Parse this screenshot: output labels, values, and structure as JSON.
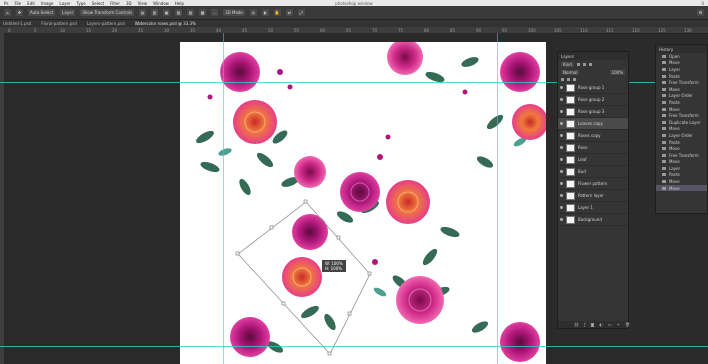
{
  "menu": {
    "items": [
      "Ps",
      "File",
      "Edit",
      "Image",
      "Layer",
      "Type",
      "Select",
      "Filter",
      "3D",
      "View",
      "Window",
      "Help"
    ],
    "title": "photoshop window",
    "right": "0"
  },
  "options": {
    "items": [
      "Auto-Select",
      "Layer",
      "Show Transform Controls",
      "",
      "",
      "",
      "",
      "",
      "",
      "3D Mode"
    ]
  },
  "tabs": [
    "Untitled-1.psd",
    "Floral-pattern.psd",
    "Layers-pattern.psd",
    "Watercolor roses.psd @ 33.3%"
  ],
  "ruler_ticks": [
    "0",
    "5",
    "10",
    "15",
    "20",
    "25",
    "30",
    "35",
    "40",
    "45",
    "50",
    "55",
    "60",
    "65",
    "70",
    "75",
    "80",
    "85",
    "90",
    "95",
    "100",
    "105",
    "110",
    "115",
    "120",
    "125",
    "130"
  ],
  "layers_panel": {
    "title": "Layers",
    "filter_label": "Kind",
    "blend_mode": "Normal",
    "opacity": "100%",
    "layers": [
      {
        "name": "Rose group 1",
        "selected": false
      },
      {
        "name": "Rose group 2",
        "selected": false
      },
      {
        "name": "Rose group 3",
        "selected": false
      },
      {
        "name": "Leaves copy",
        "selected": true
      },
      {
        "name": "Roses copy",
        "selected": false
      },
      {
        "name": "Rose",
        "selected": false
      },
      {
        "name": "Leaf",
        "selected": false
      },
      {
        "name": "Bud",
        "selected": false
      },
      {
        "name": "Flower pattern",
        "selected": false
      },
      {
        "name": "Pattern layer",
        "selected": false
      },
      {
        "name": "Layer 1",
        "selected": false
      },
      {
        "name": "Background",
        "selected": false
      }
    ]
  },
  "history_panel": {
    "title": "History",
    "items": [
      {
        "name": "Open",
        "selected": false
      },
      {
        "name": "Move",
        "selected": false
      },
      {
        "name": "Layer",
        "selected": false
      },
      {
        "name": "Paste",
        "selected": false
      },
      {
        "name": "Free Transform",
        "selected": false
      },
      {
        "name": "Move",
        "selected": false
      },
      {
        "name": "Layer Order",
        "selected": false
      },
      {
        "name": "Paste",
        "selected": false
      },
      {
        "name": "Move",
        "selected": false
      },
      {
        "name": "Free Transform",
        "selected": false
      },
      {
        "name": "Duplicate Layer",
        "selected": false
      },
      {
        "name": "Move",
        "selected": false
      },
      {
        "name": "Layer Order",
        "selected": false
      },
      {
        "name": "Paste",
        "selected": false
      },
      {
        "name": "Move",
        "selected": false
      },
      {
        "name": "Free Transform",
        "selected": false
      },
      {
        "name": "Move",
        "selected": false
      },
      {
        "name": "Layer",
        "selected": false
      },
      {
        "name": "Paste",
        "selected": false
      },
      {
        "name": "Move",
        "selected": false
      },
      {
        "name": "Move",
        "selected": true
      }
    ]
  },
  "canvas": {
    "transform_tooltip": [
      "W: 100%",
      "H: 100%"
    ],
    "rose_colors": {
      "magenta": "#b0177a",
      "pink": "#e63d8a",
      "orange": "#f07a3a",
      "leaf": "#1f5a44",
      "teal": "#2f8f7f"
    }
  }
}
